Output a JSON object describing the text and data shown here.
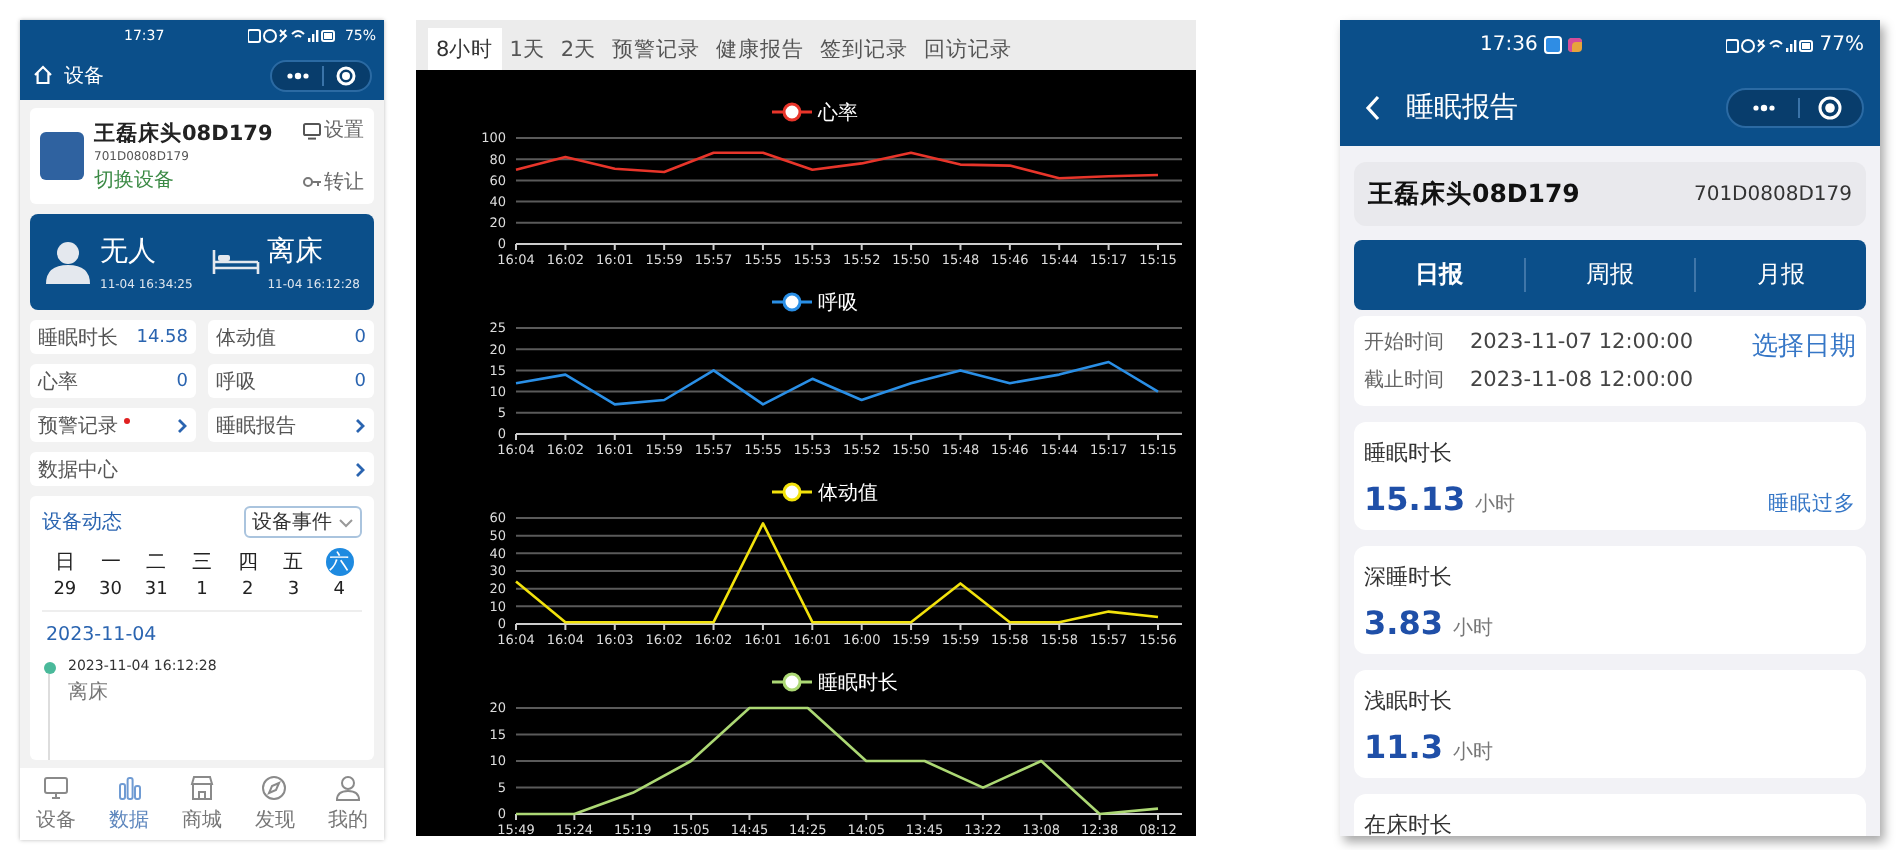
{
  "left_phone": {
    "status_bar": {
      "time": "17:37",
      "battery": "75%"
    },
    "header": {
      "title": "设备"
    },
    "device": {
      "name": "王磊床头08D179",
      "id": "701D0808D179",
      "switch_action": "切换设备",
      "settings_action": "设置",
      "transfer_action": "转让"
    },
    "presence": [
      {
        "label": "无人",
        "time": "11-04 16:34:25"
      },
      {
        "label": "离床",
        "time": "11-04 16:12:28"
      }
    ],
    "stats": [
      {
        "label": "睡眠时长",
        "value": "14.58"
      },
      {
        "label": "体动值",
        "value": "0"
      },
      {
        "label": "心率",
        "value": "0"
      },
      {
        "label": "呼吸",
        "value": "0"
      }
    ],
    "links": [
      {
        "label": "预警记录",
        "alert": true,
        "wide": false
      },
      {
        "label": "睡眠报告",
        "alert": false,
        "wide": false
      },
      {
        "label": "数据中心",
        "alert": false,
        "wide": true
      }
    ],
    "events": {
      "title": "设备动态",
      "filter": "设备事件",
      "days": [
        {
          "weekday": "日",
          "date": "29",
          "selected": false
        },
        {
          "weekday": "一",
          "date": "30",
          "selected": false
        },
        {
          "weekday": "二",
          "date": "31",
          "selected": false
        },
        {
          "weekday": "三",
          "date": "1",
          "selected": false
        },
        {
          "weekday": "四",
          "date": "2",
          "selected": false
        },
        {
          "weekday": "五",
          "date": "3",
          "selected": false
        },
        {
          "weekday": "六",
          "date": "4",
          "selected": true
        }
      ],
      "date_heading": "2023-11-04",
      "timeline": [
        {
          "time": "2023-11-04 16:12:28",
          "text": "离床"
        }
      ]
    },
    "tab_bar": [
      {
        "label": "设备",
        "selected": false
      },
      {
        "label": "数据",
        "selected": true
      },
      {
        "label": "商城",
        "selected": false
      },
      {
        "label": "发现",
        "selected": false
      },
      {
        "label": "我的",
        "selected": false
      }
    ]
  },
  "middle": {
    "tabs": [
      {
        "label": "8小时",
        "selected": true
      },
      {
        "label": "1天",
        "selected": false
      },
      {
        "label": "2天",
        "selected": false
      },
      {
        "label": "预警记录",
        "selected": false
      },
      {
        "label": "健康报告",
        "selected": false
      },
      {
        "label": "签到记录",
        "selected": false
      },
      {
        "label": "回访记录",
        "selected": false
      }
    ],
    "charts": [
      {
        "chart_data": {
          "type": "line",
          "grid": true,
          "ylim": [
            0,
            100
          ],
          "yticks": [
            0,
            20,
            40,
            60,
            80,
            100
          ],
          "categories": [
            "16:04",
            "16:02",
            "16:01",
            "15:59",
            "15:57",
            "15:55",
            "15:53",
            "15:52",
            "15:50",
            "15:48",
            "15:46",
            "15:44",
            "15:17",
            "15:15"
          ],
          "series": [
            {
              "name": "心率",
              "color": "#e8352a",
              "values": [
                70,
                82,
                71,
                68,
                86,
                86,
                70,
                76,
                86,
                75,
                74,
                62,
                64,
                65
              ]
            }
          ]
        }
      },
      {
        "chart_data": {
          "type": "line",
          "grid": true,
          "ylim": [
            0,
            25
          ],
          "yticks": [
            0,
            5,
            10,
            15,
            20,
            25
          ],
          "categories": [
            "16:04",
            "16:02",
            "16:01",
            "15:59",
            "15:57",
            "15:55",
            "15:53",
            "15:52",
            "15:50",
            "15:48",
            "15:46",
            "15:44",
            "15:17",
            "15:15"
          ],
          "series": [
            {
              "name": "呼吸",
              "color": "#2a8fe6",
              "values": [
                12,
                14,
                7,
                8,
                15,
                7,
                13,
                8,
                12,
                15,
                12,
                14,
                17,
                10
              ]
            }
          ]
        }
      },
      {
        "chart_data": {
          "type": "line",
          "grid": true,
          "ylim": [
            0,
            60
          ],
          "yticks": [
            0,
            10,
            20,
            30,
            40,
            50,
            60
          ],
          "categories": [
            "16:04",
            "16:04",
            "16:03",
            "16:02",
            "16:02",
            "16:01",
            "16:01",
            "16:00",
            "15:59",
            "15:59",
            "15:58",
            "15:58",
            "15:57",
            "15:56"
          ],
          "series": [
            {
              "name": "体动值",
              "color": "#f2e20c",
              "values": [
                24,
                1,
                1,
                1,
                1,
                57,
                1,
                1,
                1,
                23,
                1,
                1,
                7,
                4
              ]
            }
          ]
        }
      },
      {
        "chart_data": {
          "type": "line",
          "grid": true,
          "ylim": [
            0,
            20
          ],
          "yticks": [
            0,
            5,
            10,
            15,
            20
          ],
          "categories": [
            "15:49",
            "15:24",
            "15:19",
            "15:05",
            "14:45",
            "14:25",
            "14:05",
            "13:45",
            "13:22",
            "13:08",
            "12:38",
            "08:12"
          ],
          "series": [
            {
              "name": "睡眠时长",
              "color": "#acd874",
              "values": [
                0,
                0,
                4,
                10,
                20,
                20,
                10,
                10,
                5,
                10,
                0,
                1
              ]
            }
          ]
        }
      }
    ]
  },
  "right_phone": {
    "status_bar": {
      "time": "17:36",
      "battery": "77%"
    },
    "header": {
      "title": "睡眠报告"
    },
    "device": {
      "name": "王磊床头08D179",
      "id": "701D0808D179"
    },
    "tabs": [
      {
        "label": "日报",
        "selected": true
      },
      {
        "label": "周报",
        "selected": false
      },
      {
        "label": "月报",
        "selected": false
      }
    ],
    "period": {
      "rows": [
        {
          "label": "开始时间",
          "value": "2023-11-07 12:00:00"
        },
        {
          "label": "截止时间",
          "value": "2023-11-08 12:00:00"
        }
      ],
      "action": "选择日期"
    },
    "metrics": [
      {
        "label": "睡眠时长",
        "value": "15.13",
        "unit": "小时",
        "tag": "睡眠过多"
      },
      {
        "label": "深睡时长",
        "value": "3.83",
        "unit": "小时"
      },
      {
        "label": "浅眠时长",
        "value": "11.3",
        "unit": "小时"
      },
      {
        "label": "在床时长"
      }
    ]
  }
}
